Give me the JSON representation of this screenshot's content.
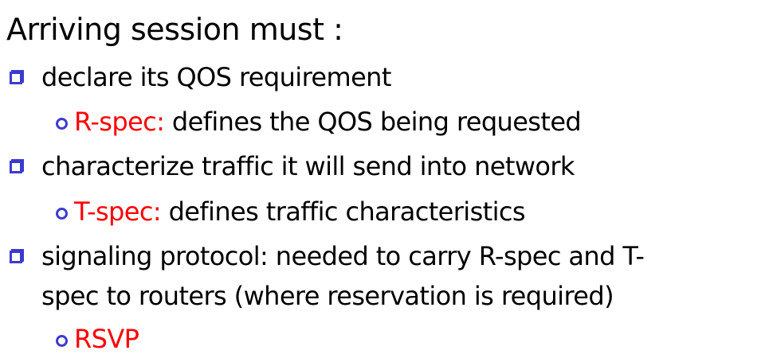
{
  "title": "Arriving session must :",
  "bullets": [
    {
      "text": "declare its QOS requirement",
      "sub": {
        "term": "R-spec:",
        "text": " defines the QOS being requested"
      }
    },
    {
      "text": "characterize traffic it will send into network",
      "sub": {
        "term": "T-spec:",
        "text": " defines traffic characteristics"
      }
    },
    {
      "text_line1": "signaling protocol: needed to carry R-spec and T-",
      "text_line2": "spec to routers (where reservation is required)",
      "sub": {
        "term": "RSVP"
      }
    }
  ],
  "colors": {
    "bullet": "#3b3bd0",
    "term": "#ff0000"
  }
}
